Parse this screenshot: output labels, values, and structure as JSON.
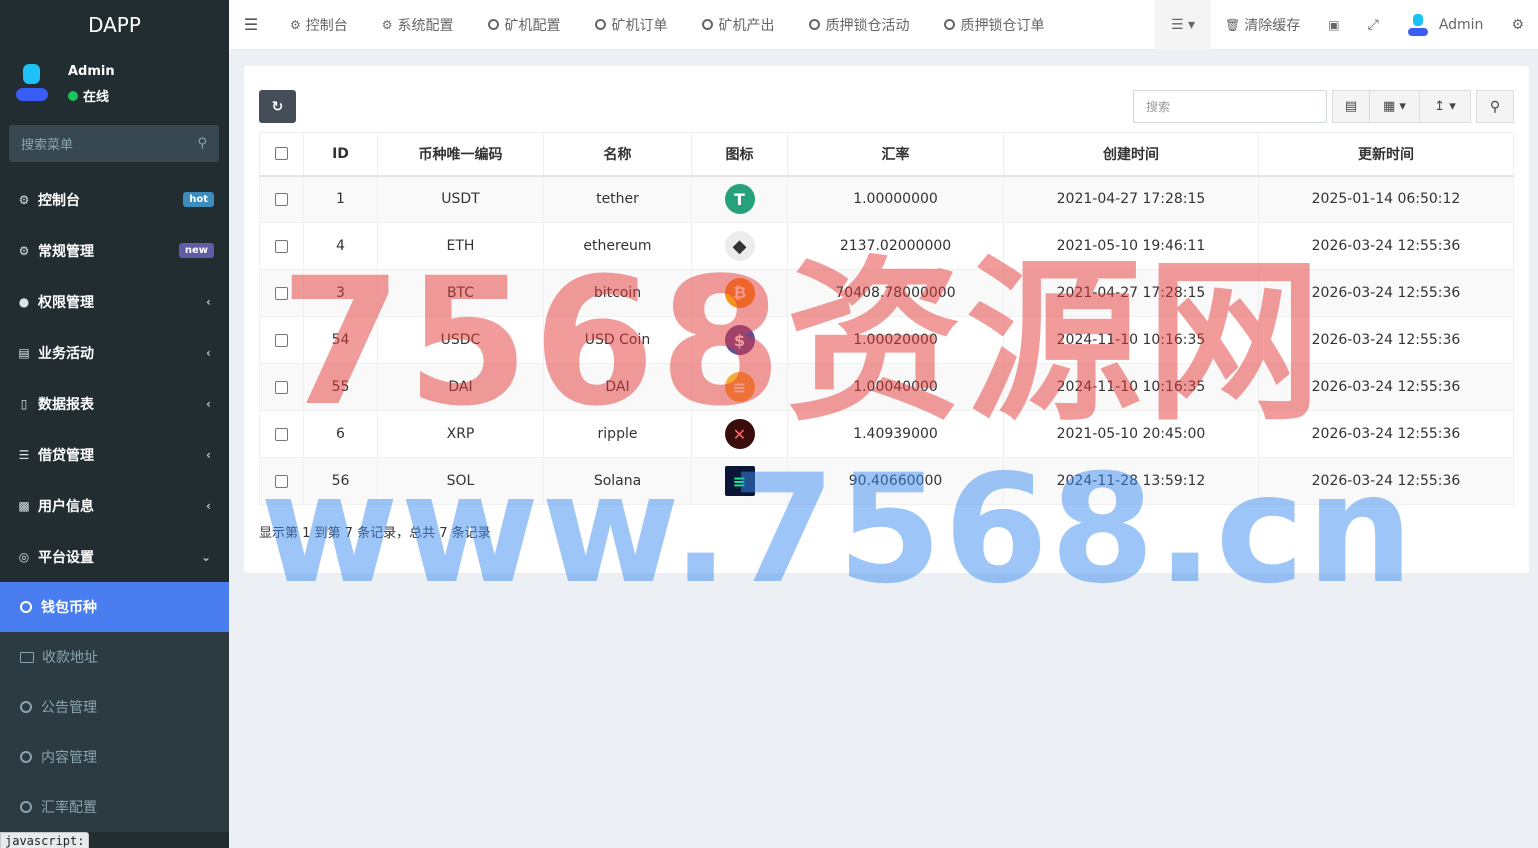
{
  "app": {
    "brand": "DAPP"
  },
  "user": {
    "name": "Admin",
    "status": "在线"
  },
  "sidebar": {
    "search_placeholder": "搜索菜单",
    "items": [
      {
        "label": "控制台",
        "icon": "dashboard-icon",
        "badge": "hot"
      },
      {
        "label": "常规管理",
        "icon": "cogs-icon",
        "badge": "new"
      },
      {
        "label": "权限管理",
        "icon": "group-icon"
      },
      {
        "label": "业务活动",
        "icon": "id-card-icon"
      },
      {
        "label": "数据报表",
        "icon": "file-icon"
      },
      {
        "label": "借贷管理",
        "icon": "list-icon"
      },
      {
        "label": "用户信息",
        "icon": "address-book-icon"
      },
      {
        "label": "平台设置",
        "icon": "target-icon"
      }
    ],
    "subitems": [
      {
        "label": "钱包币种",
        "active": true
      },
      {
        "label": "收款地址"
      },
      {
        "label": "公告管理"
      },
      {
        "label": "内容管理"
      },
      {
        "label": "汇率配置"
      }
    ]
  },
  "topnav": {
    "tabs": [
      "控制台",
      "系统配置",
      "矿机配置",
      "矿机订单",
      "矿机产出",
      "质押锁仓活动",
      "质押锁仓订单"
    ],
    "clear_cache": "清除缓存",
    "admin": "Admin"
  },
  "toolbar": {
    "search_placeholder": "搜索"
  },
  "table": {
    "headers": [
      "ID",
      "币种唯一编码",
      "名称",
      "图标",
      "汇率",
      "创建时间",
      "更新时间"
    ],
    "rows": [
      {
        "id": "1",
        "code": "USDT",
        "name": "tether",
        "icon": "tether-icon",
        "rate": "1.00000000",
        "created": "2021-04-27 17:28:15",
        "updated": "2025-01-14 06:50:12"
      },
      {
        "id": "4",
        "code": "ETH",
        "name": "ethereum",
        "icon": "ethereum-icon",
        "rate": "2137.02000000",
        "created": "2021-05-10 19:46:11",
        "updated": "2026-03-24 12:55:36"
      },
      {
        "id": "3",
        "code": "BTC",
        "name": "bitcoin",
        "icon": "bitcoin-icon",
        "rate": "70408.78000000",
        "created": "2021-04-27 17:28:15",
        "updated": "2026-03-24 12:55:36"
      },
      {
        "id": "54",
        "code": "USDC",
        "name": "USD Coin",
        "icon": "usdc-icon",
        "rate": "1.00020000",
        "created": "2024-11-10 10:16:35",
        "updated": "2026-03-24 12:55:36"
      },
      {
        "id": "55",
        "code": "DAI",
        "name": "DAI",
        "icon": "dai-icon",
        "rate": "1.00040000",
        "created": "2024-11-10 10:16:35",
        "updated": "2026-03-24 12:55:36"
      },
      {
        "id": "6",
        "code": "XRP",
        "name": "ripple",
        "icon": "xrp-icon",
        "rate": "1.40939000",
        "created": "2021-05-10 20:45:00",
        "updated": "2026-03-24 12:55:36"
      },
      {
        "id": "56",
        "code": "SOL",
        "name": "Solana",
        "icon": "solana-icon",
        "rate": "90.40660000",
        "created": "2024-11-28 13:59:12",
        "updated": "2026-03-24 12:55:36"
      }
    ]
  },
  "pager": "显示第 1 到第 7 条记录，总共 7 条记录",
  "status_tip": "javascript:",
  "watermark": {
    "line1": "7568资源网",
    "line2": "www.7568.cn"
  },
  "colors": {
    "sidebar": "#222d32",
    "active": "#4a7ef0",
    "refresh": "#444d58"
  }
}
